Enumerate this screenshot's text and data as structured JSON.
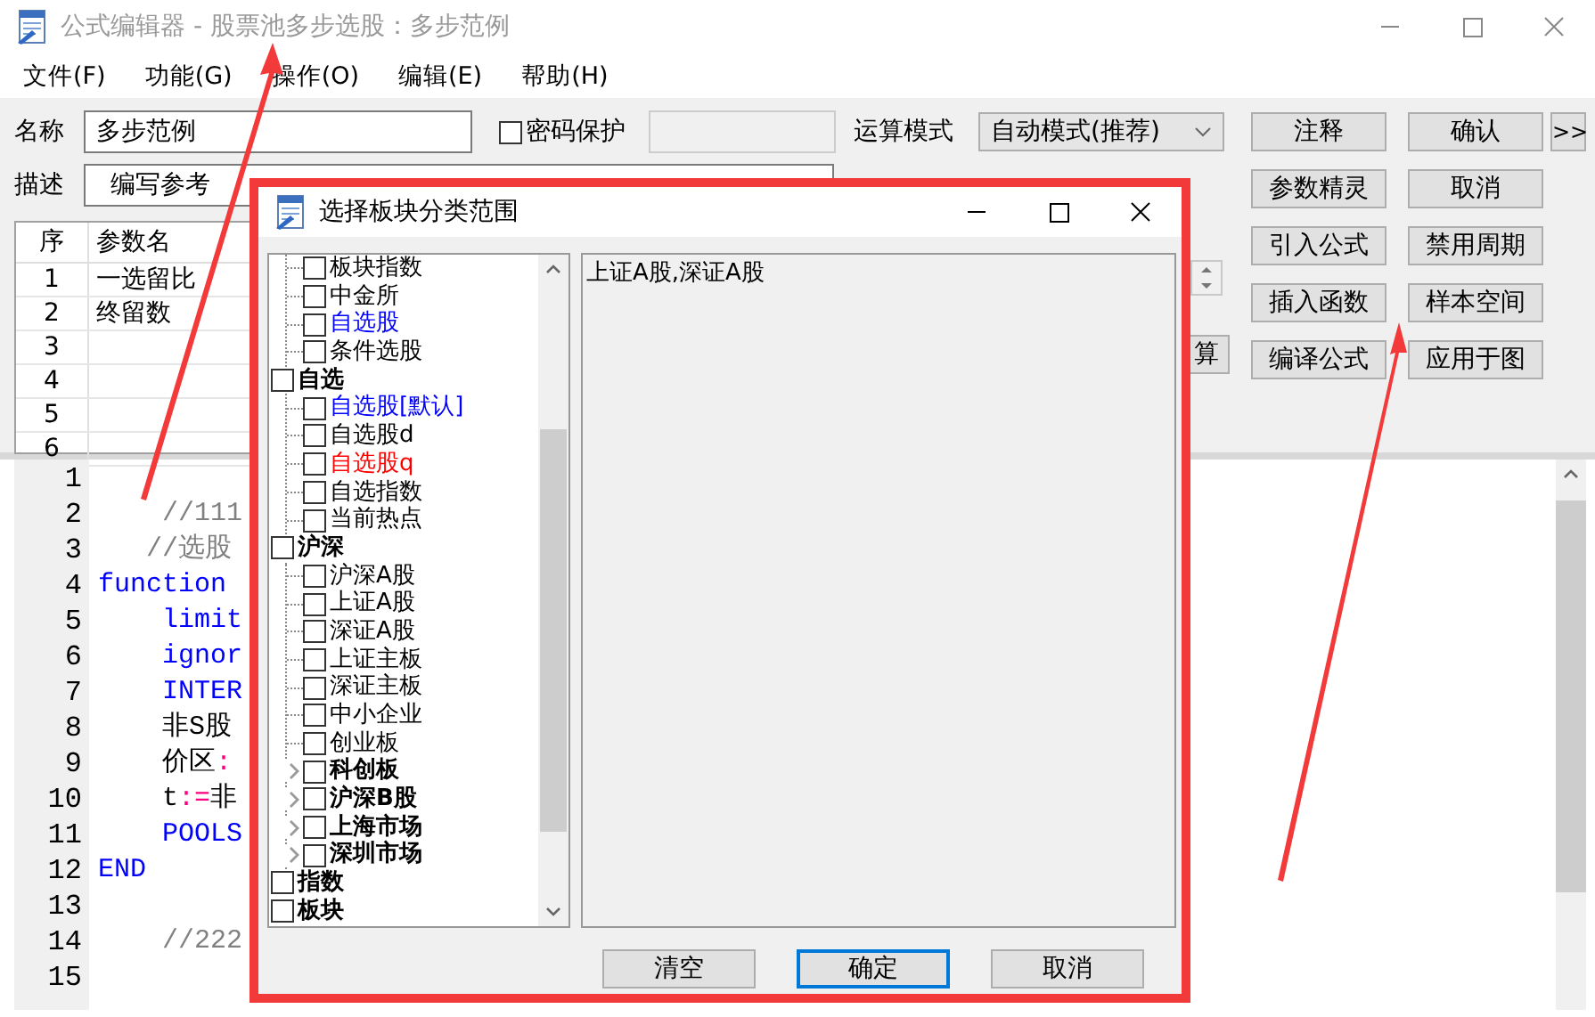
{
  "window": {
    "title": "公式编辑器 - 股票池多步选股：多步范例"
  },
  "menu": [
    "文件(F)",
    "功能(G)",
    "操作(O)",
    "编辑(E)",
    "帮助(H)"
  ],
  "form": {
    "name_label": "名称",
    "name_value": "多步范例",
    "password": {
      "label": "密码保护",
      "checked": false
    },
    "desc_label": "描述",
    "desc_value": "编写参考",
    "mode_label": "运算模式",
    "mode_value": "自动模式(推荐)"
  },
  "params": {
    "columns": [
      "序",
      "参数名"
    ],
    "rows": [
      {
        "index": "1",
        "name": "一选留比"
      },
      {
        "index": "2",
        "name": "终留数"
      },
      {
        "index": "3"
      },
      {
        "index": "4"
      },
      {
        "index": "5"
      },
      {
        "index": "6"
      }
    ]
  },
  "partial_button": "算",
  "buttons_left": [
    "注释",
    "参数精灵",
    "引入公式",
    "插入函数",
    "编译公式"
  ],
  "buttons_right": [
    "确认",
    "取消",
    "禁用周期",
    "样本空间",
    "应用于图"
  ],
  "more_button": ">>",
  "editor": {
    "lines": [
      {
        "number": "1"
      },
      {
        "number": "2",
        "segments": [
          {
            "kind": "comment",
            "text": "    //111"
          }
        ]
      },
      {
        "number": "3",
        "segments": [
          {
            "kind": "comment",
            "text": "   //选股"
          }
        ]
      },
      {
        "number": "4",
        "segments": [
          {
            "kind": "keyword",
            "text": "function"
          }
        ]
      },
      {
        "number": "5",
        "segments": [
          {
            "kind": "keyword",
            "text": "    limit"
          }
        ]
      },
      {
        "number": "6",
        "segments": [
          {
            "kind": "keyword",
            "text": "    ignor"
          }
        ]
      },
      {
        "number": "7",
        "segments": [
          {
            "kind": "keyword",
            "text": "    INTER"
          }
        ]
      },
      {
        "number": "8",
        "segments": [
          {
            "kind": "text",
            "text": "    非S股"
          }
        ]
      },
      {
        "number": "9",
        "segments": [
          {
            "kind": "text",
            "text": "    价区"
          },
          {
            "kind": "operator",
            "text": ":"
          }
        ]
      },
      {
        "number": "10",
        "segments": [
          {
            "kind": "text",
            "text": "    t"
          },
          {
            "kind": "operator",
            "text": ":="
          },
          {
            "kind": "text",
            "text": "非"
          }
        ]
      },
      {
        "number": "11",
        "segments": [
          {
            "kind": "keyword",
            "text": "    POOLS"
          }
        ]
      },
      {
        "number": "12",
        "segments": [
          {
            "kind": "keyword",
            "text": "END"
          }
        ]
      },
      {
        "number": "13"
      },
      {
        "number": "14",
        "segments": [
          {
            "kind": "comment",
            "text": "    //222"
          }
        ]
      },
      {
        "number": "15"
      }
    ]
  },
  "dialog": {
    "title": "选择板块分类范围",
    "tree": [
      {
        "kind": "group",
        "children": [
          {
            "kind": "item",
            "label": "板块指数",
            "checked": false,
            "color": "#000000"
          },
          {
            "kind": "item",
            "label": "中金所",
            "checked": false,
            "color": "#000000"
          },
          {
            "kind": "item",
            "label": "自选股",
            "checked": false,
            "color": "#0000ff"
          },
          {
            "kind": "item",
            "label": "条件选股",
            "checked": false,
            "color": "#000000"
          }
        ]
      },
      {
        "kind": "group",
        "label": "自选",
        "checked": false,
        "color": "#000000",
        "children": [
          {
            "kind": "item",
            "label": "自选股[默认]",
            "checked": false,
            "color": "#0000ff"
          },
          {
            "kind": "item",
            "label": "自选股d",
            "checked": false,
            "color": "#000000"
          },
          {
            "kind": "item",
            "label": "自选股q",
            "checked": false,
            "color": "#ff0000"
          },
          {
            "kind": "item",
            "label": "自选指数",
            "checked": false,
            "color": "#000000"
          },
          {
            "kind": "item",
            "label": "当前热点",
            "checked": false,
            "color": "#000000"
          }
        ]
      },
      {
        "kind": "group",
        "label": "沪深",
        "checked": false,
        "color": "#000000",
        "children": [
          {
            "kind": "item",
            "label": "沪深A股",
            "checked": false,
            "color": "#000000"
          },
          {
            "kind": "item",
            "label": "上证A股",
            "checked": false,
            "color": "#000000"
          },
          {
            "kind": "item",
            "label": "深证A股",
            "checked": false,
            "color": "#000000"
          },
          {
            "kind": "item",
            "label": "上证主板",
            "checked": false,
            "color": "#000000"
          },
          {
            "kind": "item",
            "label": "深证主板",
            "checked": false,
            "color": "#000000"
          },
          {
            "kind": "item",
            "label": "中小企业",
            "checked": false,
            "color": "#000000"
          },
          {
            "kind": "item",
            "label": "创业板",
            "checked": false,
            "color": "#000000"
          },
          {
            "kind": "group",
            "label": "科创板",
            "checked": false,
            "color": "#000000",
            "expanded": false
          },
          {
            "kind": "group",
            "label": "沪深B股",
            "checked": false,
            "color": "#000000",
            "expanded": false
          },
          {
            "kind": "group",
            "label": "上海市场",
            "checked": false,
            "color": "#000000",
            "expanded": false
          },
          {
            "kind": "group",
            "label": "深圳市场",
            "checked": false,
            "color": "#000000",
            "expanded": false
          }
        ]
      },
      {
        "kind": "group",
        "label": "指数",
        "checked": false,
        "color": "#000000"
      },
      {
        "kind": "group",
        "label": "板块",
        "checked": false,
        "color": "#000000"
      }
    ],
    "selection": "上证A股,深证A股",
    "buttons": [
      {
        "label": "清空",
        "default": false
      },
      {
        "label": "确定",
        "default": true
      },
      {
        "label": "取消",
        "default": false
      }
    ]
  }
}
